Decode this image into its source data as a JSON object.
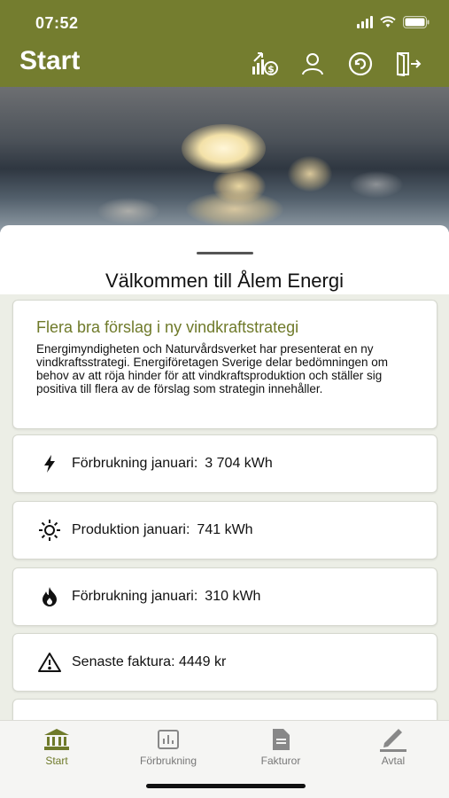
{
  "status_bar": {
    "time": "07:52"
  },
  "header": {
    "title": "Start",
    "icons": [
      "savings-growth-icon",
      "user-icon",
      "refresh-icon",
      "logout-icon"
    ]
  },
  "welcome": {
    "title": "Välkommen till Ålem Energi"
  },
  "news": {
    "title": "Flera bra förslag i ny vindkraftstrategi",
    "body": "Energimyndigheten och Naturvårdsverket har presenterat en ny vindkraftsstrategi. Energiföretagen Sverige delar bedömningen om behov av att röja hinder för att vindkraftsproduktion och ställer sig positiva till flera av de förslag som strategin innehåller."
  },
  "stats": [
    {
      "icon": "lightning-icon",
      "label": "Förbrukning januari:",
      "value": "3 704 kWh"
    },
    {
      "icon": "sun-icon",
      "label": "Produktion januari:",
      "value": "741 kWh"
    },
    {
      "icon": "flame-icon",
      "label": "Förbrukning januari:",
      "value": "310 kWh"
    },
    {
      "icon": "warning-icon",
      "label": "Senaste faktura: 4449 kr",
      "value": ""
    }
  ],
  "nav": [
    {
      "label": "Start",
      "icon": "bank-icon",
      "active": true
    },
    {
      "label": "Förbrukning",
      "icon": "chart-icon",
      "active": false
    },
    {
      "label": "Fakturor",
      "icon": "document-icon",
      "active": false
    },
    {
      "label": "Avtal",
      "icon": "pen-icon",
      "active": false
    }
  ],
  "colors": {
    "brand": "#747d2f",
    "accent_text": "#6f7a2a"
  }
}
